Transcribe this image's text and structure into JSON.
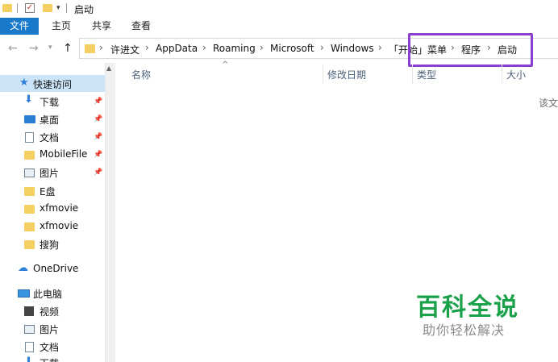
{
  "window": {
    "title": "启动"
  },
  "ribbon": {
    "tabs": [
      "文件",
      "主页",
      "共享",
      "查看"
    ]
  },
  "address": {
    "crumbs": [
      "许进文",
      "AppData",
      "Roaming",
      "Microsoft",
      "Windows",
      "「开始」菜单",
      "程序",
      "启动"
    ],
    "highlight_color": "#8a3fd1"
  },
  "nav_pane": {
    "quick_access": "快速访问",
    "items": [
      {
        "label": "下载",
        "icon": "download-arrow-icon",
        "pinned": true
      },
      {
        "label": "桌面",
        "icon": "desktop-icon",
        "pinned": true
      },
      {
        "label": "文档",
        "icon": "document-icon",
        "pinned": true
      },
      {
        "label": "MobileFile",
        "icon": "folder-icon",
        "pinned": true
      },
      {
        "label": "图片",
        "icon": "picture-icon",
        "pinned": true
      },
      {
        "label": "E盘",
        "icon": "folder-icon",
        "pinned": false
      },
      {
        "label": "xfmovie",
        "icon": "folder-icon",
        "pinned": false
      },
      {
        "label": "xfmovie",
        "icon": "folder-icon",
        "pinned": false
      },
      {
        "label": "搜狗",
        "icon": "folder-icon",
        "pinned": false
      }
    ],
    "onedrive": "OneDrive",
    "this_pc": "此电脑",
    "pc_items": [
      {
        "label": "视频",
        "icon": "video-icon"
      },
      {
        "label": "图片",
        "icon": "picture-icon"
      },
      {
        "label": "文档",
        "icon": "document-icon"
      },
      {
        "label": "下载",
        "icon": "download-arrow-icon"
      }
    ]
  },
  "columns": {
    "name": "名称",
    "modified": "修改日期",
    "type": "类型",
    "size": "大小"
  },
  "content": {
    "empty_text": "该文件夹为空。"
  },
  "watermark": {
    "title": "百科全说",
    "subtitle": "助你轻松解决",
    "color": "#1aa14a"
  },
  "colors": {
    "file_tab": "#1979ca",
    "selection": "#cce4f7",
    "folder": "#f4cf62"
  }
}
